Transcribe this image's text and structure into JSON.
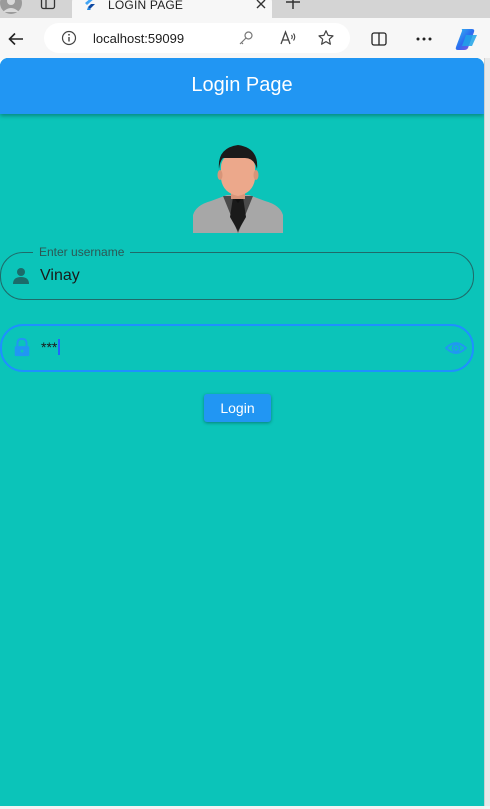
{
  "browser": {
    "tab_title": "LOGIN PAGE",
    "url": "localhost:59099",
    "icons": {
      "profile": "profile-icon",
      "tabs": "tab-actions-icon",
      "favicon": "flutter-icon",
      "close": "close-icon",
      "new_tab": "plus-icon",
      "back": "back-arrow-icon",
      "info": "info-icon",
      "key": "key-icon",
      "read_aloud": "read-aloud-icon",
      "favorite": "star-icon",
      "split": "split-screen-icon",
      "more": "more-icon",
      "copilot": "copilot-icon"
    }
  },
  "app": {
    "title": "Login Page",
    "colors": {
      "app_bar": "#2196f3",
      "background": "#0bc4b9",
      "focus": "#1e90ff"
    },
    "username": {
      "label": "Enter username",
      "value": "Vinay",
      "icon": "person-icon"
    },
    "password": {
      "value": "***",
      "icon": "lock-icon",
      "toggle_icon": "eye-icon"
    },
    "login_label": "Login"
  }
}
